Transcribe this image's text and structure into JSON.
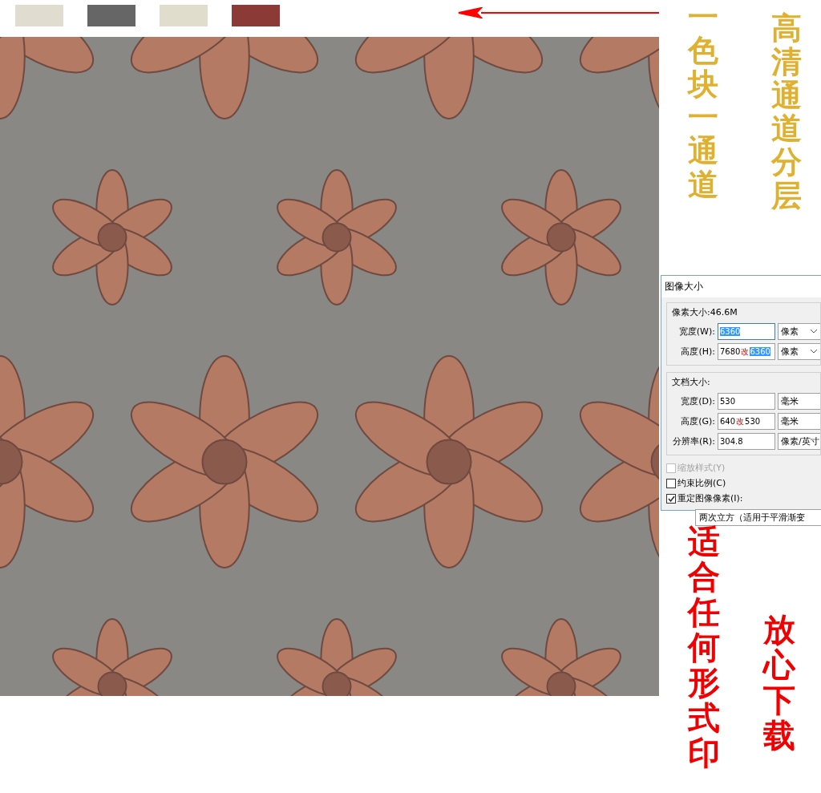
{
  "swatches": [
    {
      "color": "#e0ddd0"
    },
    {
      "color": "#666666"
    },
    {
      "color": "#e0ddcd"
    },
    {
      "color": "#8b3a36"
    }
  ],
  "slogans": {
    "gold": [
      "一色块一通道",
      "高清通道分层"
    ],
    "red": [
      "适合任何形式印",
      "放心下载"
    ]
  },
  "dialog": {
    "title": "图像大小",
    "groups": [
      {
        "title": "像素大小:46.6M",
        "rows": [
          {
            "label": "宽度(W):",
            "new_value": "6360",
            "highlighted": true,
            "unit": "像素",
            "dropdown": true
          },
          {
            "label": "高度(H):",
            "value": "7680",
            "mark": "改",
            "new_value": "6360",
            "highlighted": true,
            "unit": "像素",
            "dropdown": true
          }
        ]
      },
      {
        "title": "文档大小:",
        "rows": [
          {
            "label": "宽度(D):",
            "value": "530",
            "unit": "毫米",
            "dropdown": false
          },
          {
            "label": "高度(G):",
            "value": "640",
            "mark": "改",
            "new_value": "530",
            "highlighted": false,
            "unit": "毫米",
            "dropdown": false
          },
          {
            "label": "分辨率(R):",
            "value": "304.8",
            "unit": "像素/英寸",
            "dropdown": false
          }
        ]
      }
    ],
    "checkboxes": [
      {
        "label": "缩放样式(Y)",
        "checked": false,
        "disabled": true
      },
      {
        "label": "约束比例(C)",
        "checked": false,
        "disabled": false
      },
      {
        "label": "重定图像像素(I):",
        "checked": true,
        "disabled": false
      }
    ],
    "resample": "两次立方（适用于平滑渐变"
  }
}
